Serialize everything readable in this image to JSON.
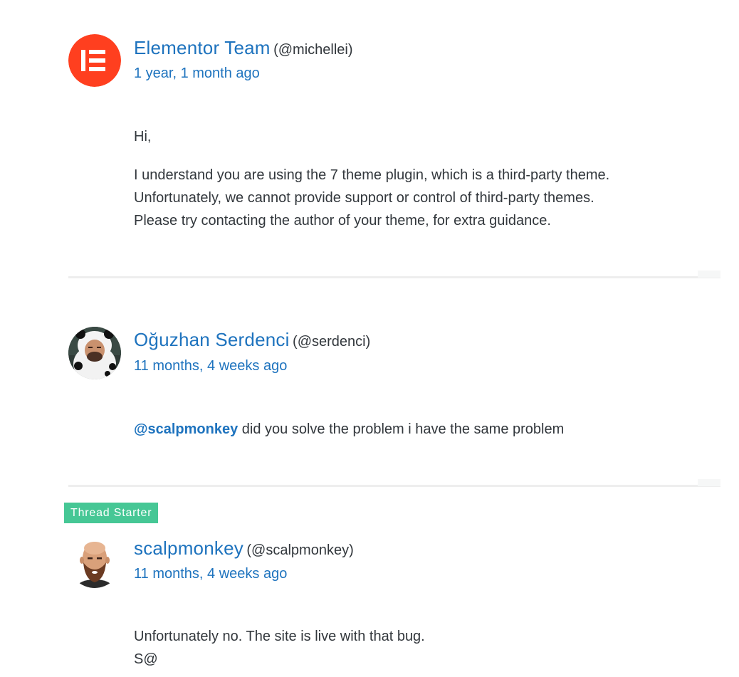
{
  "replies": [
    {
      "author_name": "Elementor Team",
      "author_handle": "(@michellei)",
      "time": "1 year, 1 month ago",
      "paragraphs": [
        "Hi,",
        "I understand you are using the 7 theme plugin, which is a third-party theme.\nUnfortunately, we cannot provide support or control of third-party themes.\nPlease try contacting the author of your theme, for extra guidance."
      ]
    },
    {
      "author_name": "Oğuzhan Serdenci",
      "author_handle": "(@serdenci)",
      "time": "11 months, 4 weeks ago",
      "mention": "@scalpmonkey",
      "text": " did you solve the problem i have the same problem"
    },
    {
      "badge": "Thread Starter",
      "author_name": "scalpmonkey",
      "author_handle": "(@scalpmonkey)",
      "time": "11 months, 4 weeks ago",
      "lines": [
        "Unfortunately no. The site is live with that bug.",
        "S@"
      ]
    }
  ],
  "colors": {
    "link": "#1e73be",
    "text": "#32373c",
    "badge": "#46c795",
    "elementor": "#ff3f1f"
  },
  "icons": [
    "elementor-logo-icon",
    "panda-costume-avatar",
    "bald-bearded-cartoon-avatar"
  ]
}
